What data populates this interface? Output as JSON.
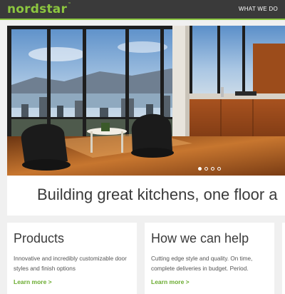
{
  "header": {
    "logo_text": "nordstar",
    "logo_mark": "™",
    "nav": [
      "WHAT WE DO"
    ]
  },
  "hero": {
    "image_description_icon": "kitchen-photo",
    "slides_total": 4,
    "active_slide": 1
  },
  "headline": "Building great kitchens, one floor a",
  "cards": [
    {
      "title": "Products",
      "body": "Innovative and incredibly customizable door styles and finish options",
      "link": "Learn more >"
    },
    {
      "title": "How we can help",
      "body": "Cutting edge style and quality. On time, complete deliveries in budget. Period.",
      "link": "Learn more >"
    }
  ],
  "colors": {
    "brand_green": "#8cc63f",
    "link_green": "#6aab2f",
    "topbar": "#3a3a3a",
    "page_bg": "#f0f0f0"
  }
}
